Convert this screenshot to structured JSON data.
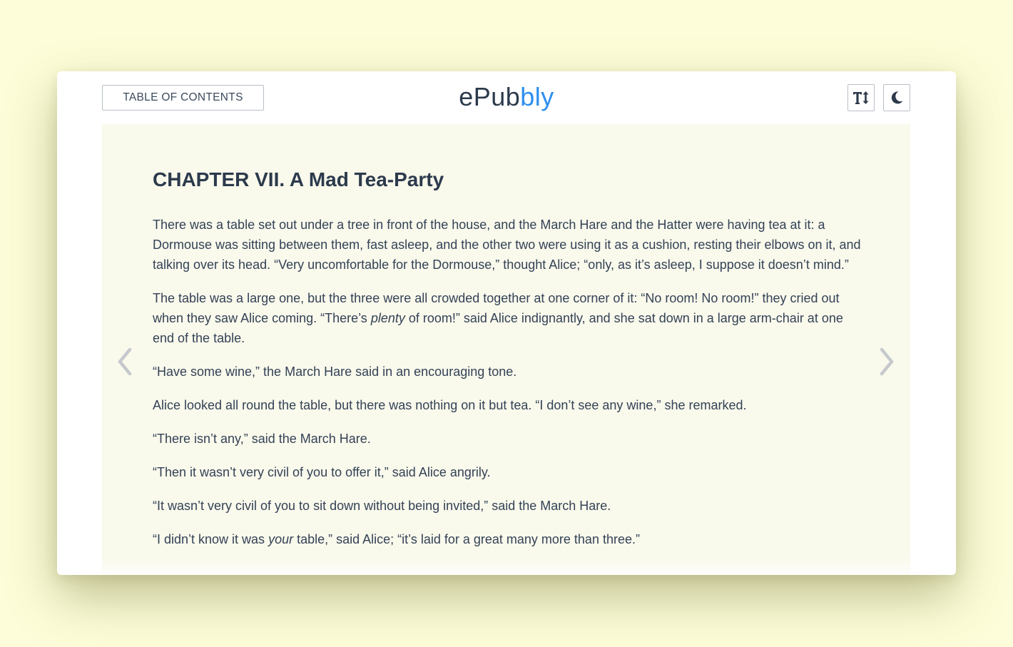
{
  "header": {
    "toc_label": "TABLE OF CONTENTS",
    "brand_prefix": "ePub",
    "brand_suffix": "bly",
    "font_size_icon": "text-size-icon",
    "theme_icon": "moon-icon"
  },
  "colors": {
    "background": "#fdfdd9",
    "reader_background": "#f9f9ec",
    "text": "#2c3a4c",
    "brand_accent": "#2d8ef0",
    "arrow": "#c5c8cc"
  },
  "chapter": {
    "title": "CHAPTER VII. A Mad Tea-Party",
    "paragraphs": [
      [
        {
          "text": "There was a table set out under a tree in front of the house, and the March Hare and the Hatter were having tea at it: a Dormouse was sitting between them, fast asleep, and the other two were using it as a cushion, resting their elbows on it, and talking over its head. “Very uncomfortable for the Dormouse,” thought Alice; “only, as it’s asleep, I suppose it doesn’t mind.”"
        }
      ],
      [
        {
          "text": "The table was a large one, but the three were all crowded together at one corner of it: “No room! No room!” they cried out when they saw Alice coming. “There’s "
        },
        {
          "text": "plenty",
          "italic": true
        },
        {
          "text": " of room!” said Alice indignantly, and she sat down in a large arm-chair at one end of the table."
        }
      ],
      [
        {
          "text": "“Have some wine,” the March Hare said in an encouraging tone."
        }
      ],
      [
        {
          "text": "Alice looked all round the table, but there was nothing on it but tea. “I don’t see any wine,” she remarked."
        }
      ],
      [
        {
          "text": "“There isn’t any,” said the March Hare."
        }
      ],
      [
        {
          "text": "“Then it wasn’t very civil of you to offer it,” said Alice angrily."
        }
      ],
      [
        {
          "text": "“It wasn’t very civil of you to sit down without being invited,” said the March Hare."
        }
      ],
      [
        {
          "text": "“I didn’t know it was "
        },
        {
          "text": "your",
          "italic": true
        },
        {
          "text": " table,” said Alice; “it’s laid for a great many more than three.”"
        }
      ]
    ]
  },
  "navigation": {
    "prev_icon": "chevron-left-icon",
    "next_icon": "chevron-right-icon"
  }
}
